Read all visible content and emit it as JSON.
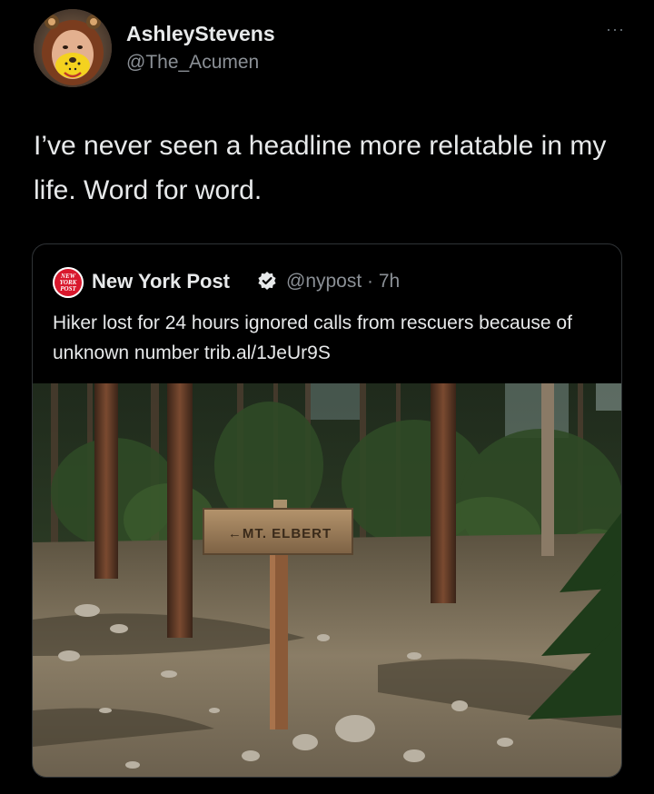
{
  "tweet": {
    "author_name": "AshleyStevens",
    "author_handle": "@The_Acumen",
    "more_menu": "···",
    "text": "I’ve never seen a headline more relatable in my life. Word for word."
  },
  "quoted_tweet": {
    "author_name": "New York Post",
    "handle_time": "@nypost · 7h",
    "text": "Hiker lost for 24 hours ignored calls from rescuers because of unknown number trib.al/1JeUr9S",
    "logo_text": [
      "NEW",
      "YORK",
      "POST"
    ],
    "photo": {
      "sign_text": "←MT. ELBERT"
    }
  },
  "colors": {
    "background": "#000000",
    "text": "#e7e9ea",
    "secondary_text": "#8b9096",
    "verified_badge": "#e7e9ea",
    "border": "#2f3336",
    "nypost_red": "#d9182d"
  }
}
